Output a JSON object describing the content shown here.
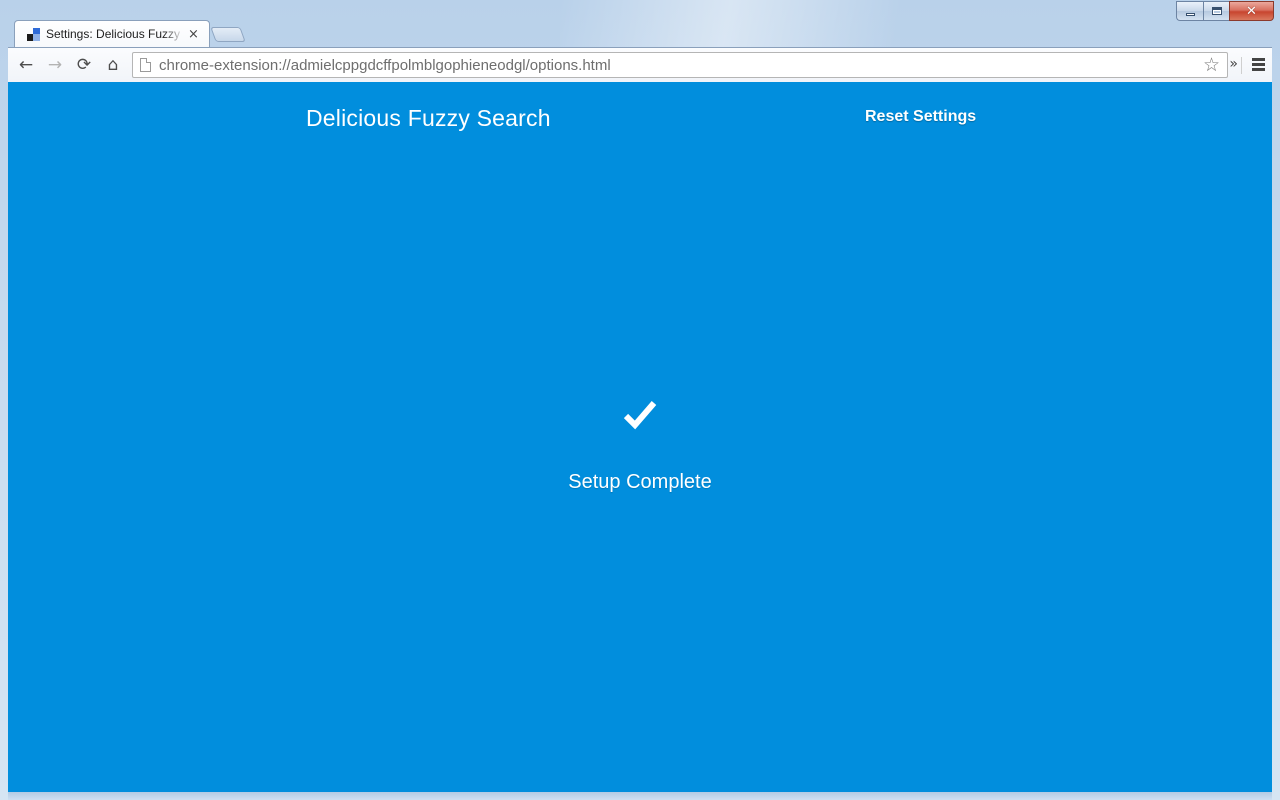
{
  "browser": {
    "tab": {
      "title": "Settings: Delicious Fuzzy S",
      "close_glyph": "×",
      "favicon": "delicious-favicon-icon"
    },
    "new_tab": "new-tab-button",
    "window_controls": {
      "minimize": "minimize-icon",
      "maximize": "maximize-icon",
      "close_glyph": "✕"
    },
    "toolbar": {
      "back_glyph": "←",
      "forward_glyph": "→",
      "reload_glyph": "⟳",
      "home_glyph": "⌂",
      "url": "chrome-extension://admielcppgdcffpolmblgophieneodgl/options.html",
      "star_glyph": "☆",
      "extensions_glyph": "»"
    }
  },
  "page": {
    "background_color": "#018edd",
    "title": "Delicious Fuzzy Search",
    "reset_label": "Reset Settings",
    "status": {
      "icon": "checkmark-icon",
      "text": "Setup Complete"
    }
  }
}
